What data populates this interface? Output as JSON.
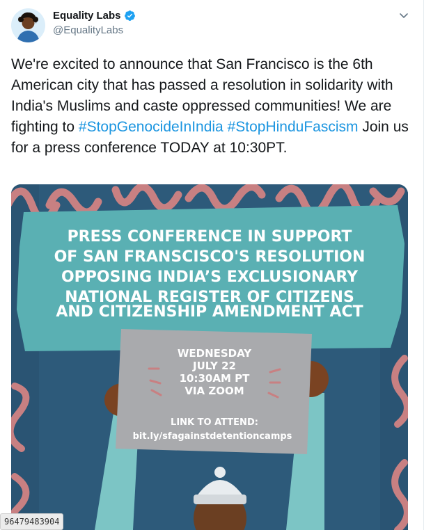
{
  "tweet": {
    "author_name": "Equality Labs",
    "author_handle": "@EqualityLabs",
    "text_parts": {
      "intro": "We're excited to announce that San Francisco is the 6th American city that has passed a resolution in solidarity with India's Muslims and caste oppressed communities! We are fighting to ",
      "hashtag1": "#StopGenocideInIndia",
      "space": " ",
      "hashtag2": "#StopHinduFascism",
      "outro": " Join us for a press conference TODAY at 10:30PT."
    }
  },
  "poster": {
    "headline_lines": [
      "PRESS CONFERENCE IN SUPPORT",
      "OF SAN FRANSCISCO'S RESOLUTION",
      "OPPOSING INDIA’S EXCLUSIONARY",
      "NATIONAL REGISTER OF CITIZENS",
      "AND CITIZENSHIP AMENDMENT ACT"
    ],
    "sign_lines": [
      "WEDNESDAY",
      "JULY 22",
      "10:30AM PT",
      "VIA ZOOM"
    ],
    "link_label": "LINK TO ATTEND:",
    "link_url": "bit.ly/sfagainstdetentioncamps"
  },
  "overlay": {
    "id_text": "96479483904"
  },
  "colors": {
    "poster_bg": "#2d5a7a",
    "banner": "#5ab0b3",
    "sign": "#a9aaad",
    "coral": "#c88082",
    "hashtag": "#1b95e0",
    "verified": "#1da1f2"
  }
}
